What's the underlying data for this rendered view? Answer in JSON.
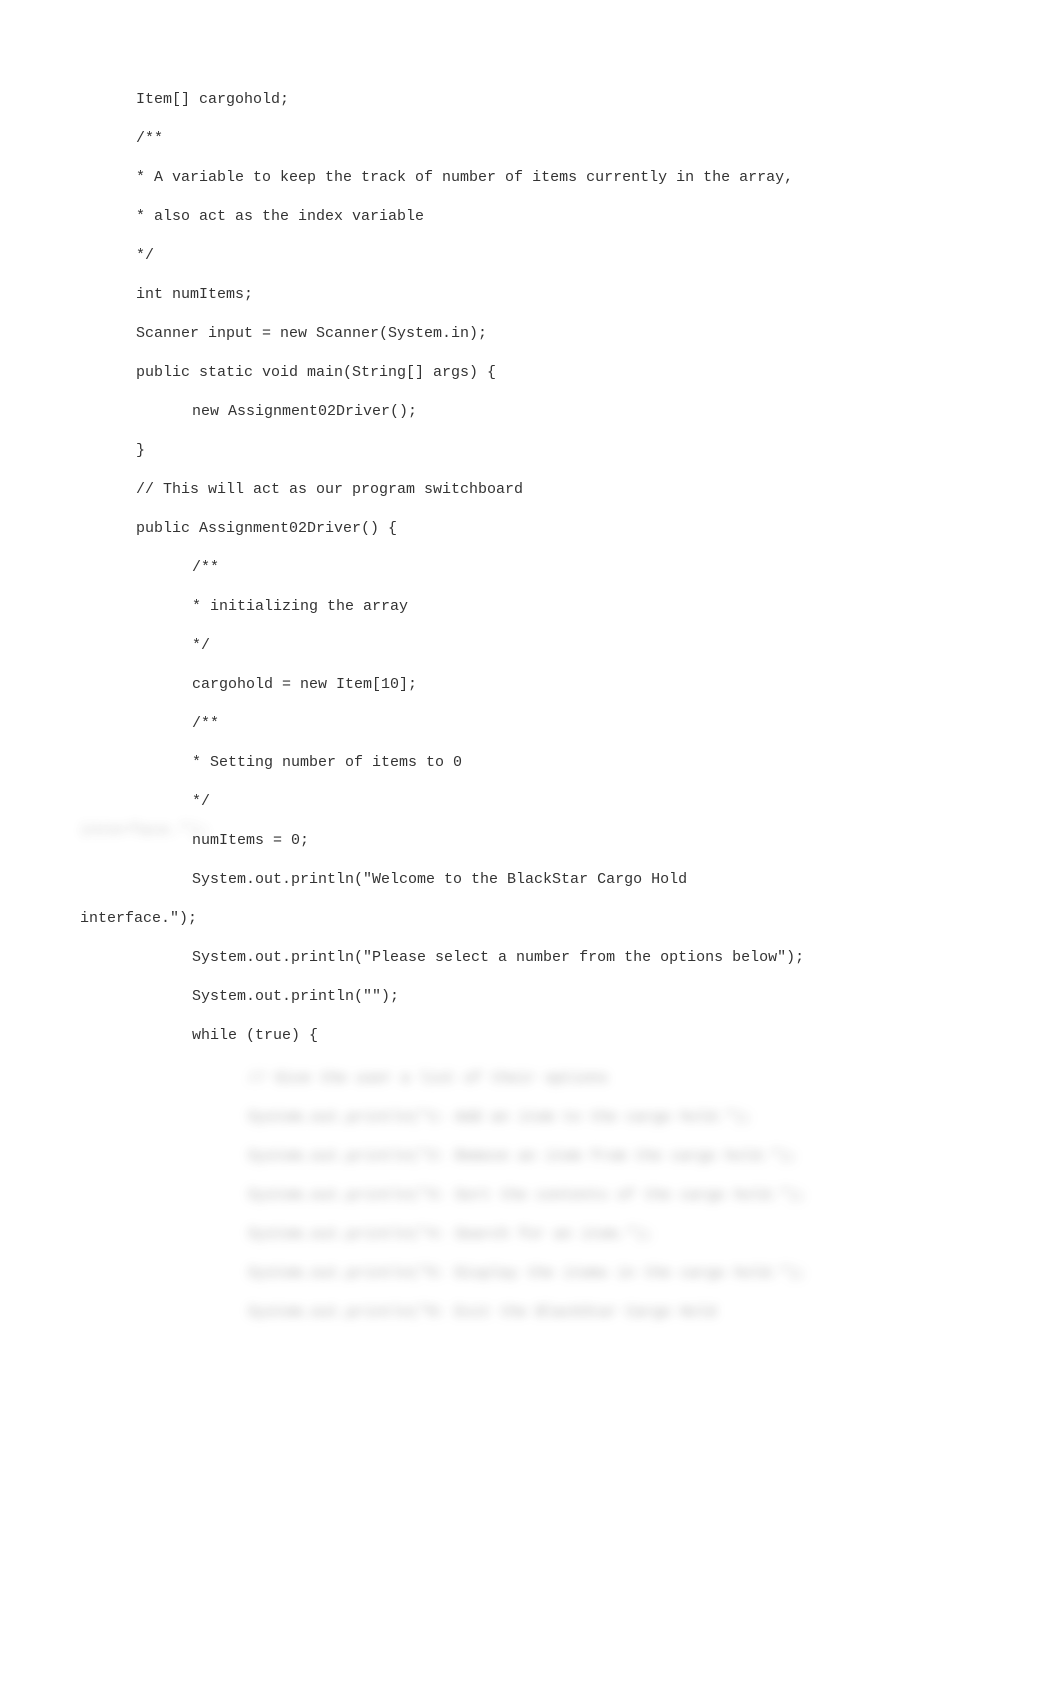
{
  "lines": [
    {
      "cls": "indent-1",
      "text": "Item[] cargohold;"
    },
    {
      "cls": "indent-1",
      "text": "/**"
    },
    {
      "cls": "indent-1",
      "text": "* A variable to keep the track of number of items currently in the array,"
    },
    {
      "cls": "indent-1",
      "text": "* also act as the index variable"
    },
    {
      "cls": "indent-1",
      "text": "*/"
    },
    {
      "cls": "indent-1",
      "text": "int numItems;"
    },
    {
      "cls": "indent-1",
      "text": "Scanner input = new Scanner(System.in);"
    },
    {
      "cls": "indent-1",
      "text": "public static void main(String[] args) {"
    },
    {
      "cls": "indent-2",
      "text": "new Assignment02Driver();"
    },
    {
      "cls": "indent-1",
      "text": "}"
    },
    {
      "cls": "indent-1",
      "text": "// This will act as our program switchboard"
    },
    {
      "cls": "indent-1",
      "text": "public Assignment02Driver() {"
    },
    {
      "cls": "indent-2",
      "text": "/**"
    },
    {
      "cls": "indent-2",
      "text": "* initializing the array"
    },
    {
      "cls": "indent-2",
      "text": "*/"
    },
    {
      "cls": "indent-2",
      "text": "cargohold = new Item[10];"
    },
    {
      "cls": "indent-2",
      "text": "/**"
    },
    {
      "cls": "indent-2",
      "text": "* Setting number of items to 0"
    },
    {
      "cls": "indent-2",
      "text": "*/"
    },
    {
      "cls": "indent-2",
      "text": "numItems = 0;"
    },
    {
      "cls": "indent-2",
      "text": "System.out.println(\"Welcome to the BlackStar Cargo Hold"
    },
    {
      "cls": "wrap-indent",
      "text": "interface.\");"
    },
    {
      "cls": "indent-2",
      "text": "System.out.println(\"Please select a number from the options below\");"
    },
    {
      "cls": "indent-2",
      "text": "System.out.println(\"\");"
    },
    {
      "cls": "indent-2",
      "text": "while (true) {"
    }
  ],
  "blurred": [
    {
      "cls": "indent-3",
      "text": "// Give the user a list of their options"
    },
    {
      "cls": "indent-3",
      "text": "System.out.println(\"1: Add an item to the cargo hold.\");"
    },
    {
      "cls": "indent-3",
      "text": "System.out.println(\"2: Remove an item from the cargo hold.\");"
    },
    {
      "cls": "indent-3",
      "text": "System.out.println(\"3: Sort the contents of the cargo hold.\");"
    },
    {
      "cls": "indent-3",
      "text": "System.out.println(\"4: Search for an item.\");"
    },
    {
      "cls": "indent-3",
      "text": "System.out.println(\"5: Display the items in the cargo hold.\");"
    },
    {
      "cls": "indent-3",
      "text": "System.out.println(\"0: Exit the BlackStar Cargo Hold"
    }
  ],
  "watermark": "interface.\");"
}
